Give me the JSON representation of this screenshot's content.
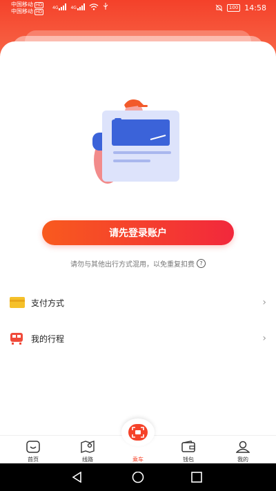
{
  "status_bar": {
    "carrier1": "中国移动",
    "carrier2": "中国移动",
    "hd": "HD",
    "net1": "4G",
    "net2": "4G",
    "battery": "100",
    "time": "14:58"
  },
  "login": {
    "button_label": "请先登录账户",
    "hint": "请勿与其他出行方式混用，以免重复扣费",
    "hint_icon": "?"
  },
  "menu": [
    {
      "label": "支付方式",
      "icon": "card-icon"
    },
    {
      "label": "我的行程",
      "icon": "train-icon"
    }
  ],
  "tabs": [
    {
      "label": "首页",
      "icon": "home-icon"
    },
    {
      "label": "线路",
      "icon": "map-icon"
    },
    {
      "label": "乘车",
      "icon": "scan-ride-icon",
      "active": true
    },
    {
      "label": "钱包",
      "icon": "wallet-icon"
    },
    {
      "label": "我的",
      "icon": "user-icon"
    }
  ],
  "colors": {
    "accent": "#f5432a",
    "gradient_start": "#f85a1e",
    "gradient_end": "#f2283c"
  }
}
